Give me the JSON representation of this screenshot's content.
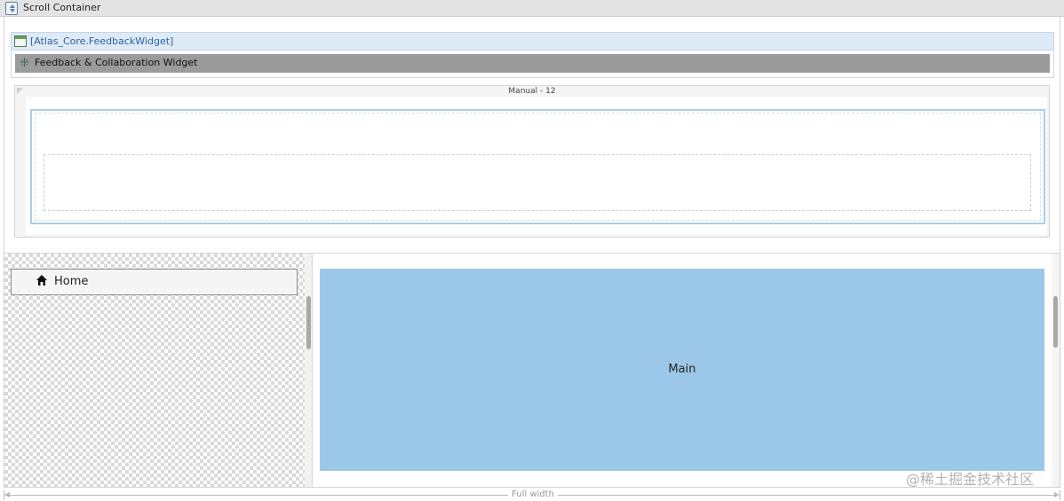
{
  "header": {
    "title": "Scroll Container",
    "icon": "scroll-container-icon"
  },
  "widget": {
    "snippet_label": "[Atlas_Core.FeedbackWidget]",
    "snippet_icon": "snippet-icon",
    "bar_label": "Feedback & Collaboration Widget",
    "bar_icon": "widget-icon"
  },
  "layout_grid": {
    "label": "Manual - 12"
  },
  "sidebar": {
    "items": [
      {
        "label": "Home",
        "icon": "home-icon"
      }
    ]
  },
  "main": {
    "label": "Main"
  },
  "ruler": {
    "label": "Full width"
  },
  "watermark": "@稀土掘金技术社区",
  "colors": {
    "main_region": "#9bc8e8",
    "column_border": "#a9cfe5",
    "snippet_header": "#deebf7",
    "widget_bar": "#9b9b9b"
  }
}
